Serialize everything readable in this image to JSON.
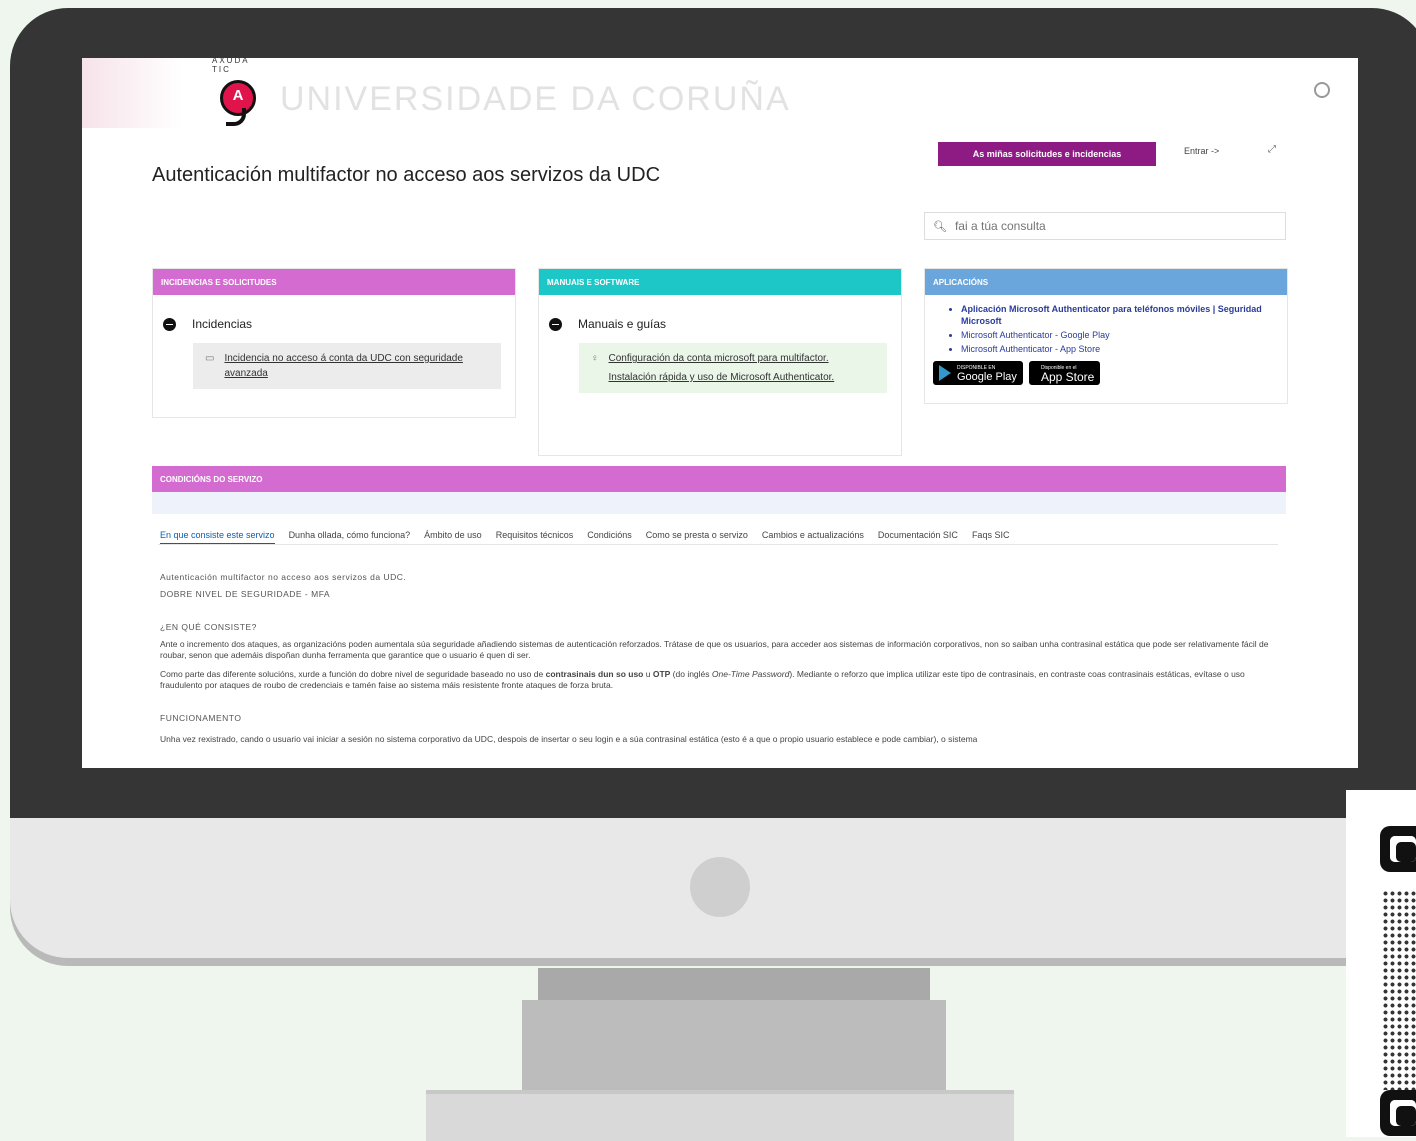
{
  "brand": {
    "logo_text": "AXUDA TIC",
    "logo_glyph": "A",
    "university": "UNIVERSIDADE DA CORUÑA"
  },
  "header": {
    "page_title": "Autenticación multifactor no acceso aos servizos da UDC",
    "requests_button": "As miñas solicitudes e incidencias",
    "login_link": "Entrar ->",
    "search_placeholder": "fai a túa consulta"
  },
  "cards": [
    {
      "header": "INCIDENCIAS E SOLICITUDES",
      "color": "#d46bd0",
      "section": "Incidencias",
      "items": [
        "Incidencia no acceso á conta da UDC con seguridade avanzada"
      ],
      "item_bg": "#ececec"
    },
    {
      "header": "MANUAIS E SOFTWARE",
      "color": "#1ec7c7",
      "section": "Manuais e guías",
      "items": [
        "Configuración da conta microsoft para multifactor.",
        "Instalación rápida y uso de Microsoft Authenticator."
      ],
      "item_bg": "#e9f6e8"
    },
    {
      "header": "APLICACIÓNS",
      "color": "#6aa6dc",
      "links": [
        "Aplicación Microsoft Authenticator para teléfonos móviles | Seguridad Microsoft",
        "Microsoft Authenticator - Google Play",
        "Microsoft Authenticator - App Store"
      ],
      "badge_google_top": "DISPONIBLE EN",
      "badge_google": "Google Play",
      "badge_apple_top": "Disponible en el",
      "badge_apple": "App Store"
    }
  ],
  "conditions": {
    "header": "CONDICIÓNS DO SERVIZO",
    "tabs": [
      "En que consiste este servizo",
      "Dunha ollada, cómo funciona?",
      "Ámbito de uso",
      "Requisitos técnicos",
      "Condicións",
      "Como se presta o servizo",
      "Cambios e actualizacións",
      "Documentación SIC",
      "Faqs SIC"
    ],
    "intro": "Autenticación multifactor no acceso aos servizos da UDC.",
    "subtitle": "DOBRE NIVEL DE SEGURIDADE - MFA",
    "q_heading": "¿EN QUÉ CONSISTE?",
    "p1": "Ante o incremento dos ataques, as organizacións poden aumentala súa seguridade añadiendo sistemas de autenticación reforzados. Trátase de que os usuarios, para acceder aos sistemas de información corporativos, non so saiban unha contrasinal estática que pode ser relativamente fácil de roubar, senon que ademáis dispoñan dunha ferramenta que garantice que o usuario é quen di ser.",
    "p2a": "Como parte das diferente solucións, xurde a función do dobre nivel de seguridade baseado no uso de ",
    "p2b": "contrasinais dun so uso",
    "p2c": " u ",
    "p2d": "OTP",
    "p2e": " (do inglés ",
    "p2f": "One-Time Password",
    "p2g": "). Mediante o reforzo que implica utilizar este tipo de contrasinais, en contraste coas contrasinais estáticas, evítase o uso fraudulento por ataques de roubo de credenciais e tamén faise ao sistema máis resistente fronte ataques de forza bruta.",
    "f_heading": "FUNCIONAMENTO",
    "p3": "Unha vez rexistrado, cando o usuario vai iniciar a sesión no sistema corporativo da UDC, despois de insertar o seu login e a súa contrasinal estática (esto é a que o propio usuario establece e pode cambiar), o sistema"
  }
}
